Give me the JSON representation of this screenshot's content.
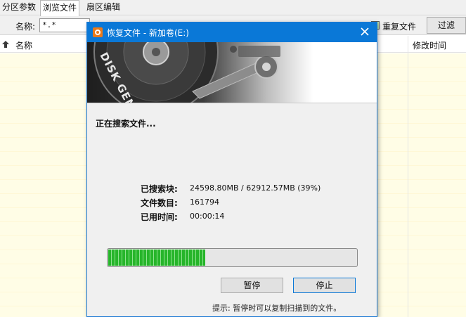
{
  "main": {
    "tabs": [
      {
        "label": "分区参数"
      },
      {
        "label": "浏览文件"
      },
      {
        "label": "扇区编辑"
      }
    ],
    "filter": {
      "name_label": "名称:",
      "name_value": "*.*",
      "duplicate_files_label": "重复文件",
      "filter_button": "过滤"
    },
    "columns": {
      "name": "名称",
      "modified_time": "修改时间"
    }
  },
  "dialog": {
    "title": "恢复文件 - 新加卷(E:)",
    "banner_text": "DISK GENIUS",
    "status_heading": "正在搜索文件...",
    "stats": {
      "searched_blocks_label": "已搜索块:",
      "searched_blocks_value": "24598.80MB / 62912.57MB (39%)",
      "file_count_label": "文件数目:",
      "file_count_value": "161794",
      "elapsed_label": "已用时间:",
      "elapsed_value": "00:00:14"
    },
    "progress_percent": 39,
    "pause_button": "暂停",
    "stop_button": "停止",
    "hint": "提示: 暂停时可以复制扫描到的文件。"
  },
  "colors": {
    "titlebar": "#0a78d7",
    "progress_green": "#26b52a",
    "list_row_yellow": "#fffde6"
  },
  "icons": {
    "sort": "sort-up-icon",
    "close": "close-icon",
    "app": "disk-genius-app-icon"
  }
}
